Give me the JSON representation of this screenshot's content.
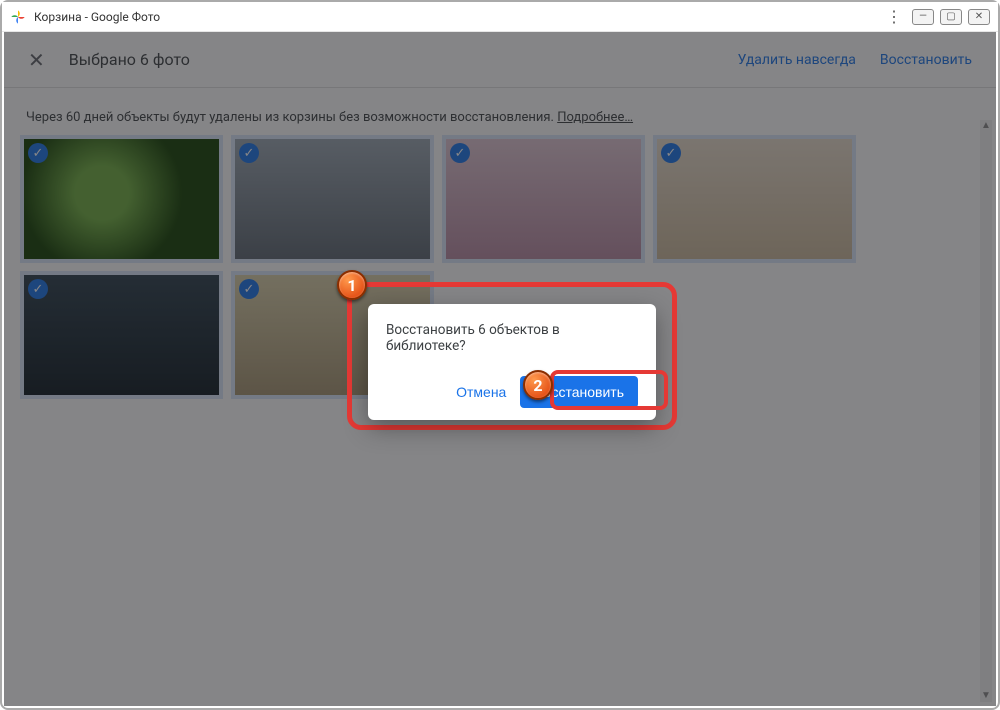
{
  "window": {
    "title": "Корзина - Google Фото"
  },
  "header": {
    "selection": "Выбрано 6 фото",
    "delete_forever": "Удалить навсегда",
    "restore": "Восстановить"
  },
  "notice": {
    "text": "Через 60 дней объекты будут удалены из корзины без возможности восстановления. ",
    "more": "Подробнее…"
  },
  "dialog": {
    "message": "Восстановить 6 объектов в библиотеке?",
    "cancel": "Отмена",
    "restore": "Восстановить"
  },
  "markers": {
    "one": "1",
    "two": "2"
  },
  "thumbs": [
    "bokeh",
    "dog-hat",
    "puppies-field",
    "guinea-pig",
    "monkey",
    "dog-brown"
  ]
}
